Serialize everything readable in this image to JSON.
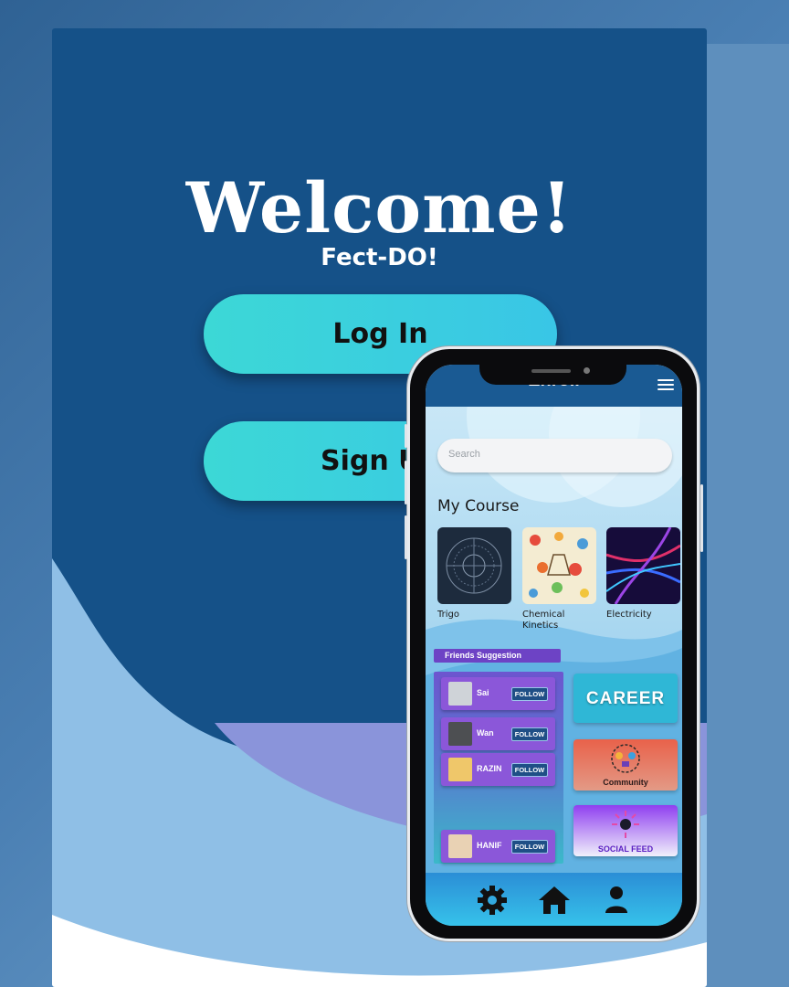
{
  "welcome": {
    "title": "Welcome!",
    "subtitle": "Fect-DO!"
  },
  "buttons": {
    "login": "Log In",
    "signup": "Sign Up"
  },
  "app": {
    "header_title": "Enroll",
    "search_placeholder": "Search",
    "section_title": "My Course",
    "courses": [
      {
        "label": "Trigo"
      },
      {
        "label": "Chemical Kinetics"
      },
      {
        "label": "Electricity"
      }
    ],
    "friends_title": "Friends Suggestion",
    "follow_label": "FOLLOW",
    "friends": [
      "Sai",
      "Wan",
      "RAZIN",
      "HANIF"
    ],
    "tiles": {
      "career": "CAREER",
      "community": "Community",
      "social": "SOCIAL FEED"
    },
    "nav": [
      "gear-icon",
      "home-icon",
      "user-icon"
    ]
  },
  "colors": {
    "card": "#155188",
    "button": "#3cd8d6",
    "header": "#1a5a93",
    "friends_panel": "#6d43c5"
  }
}
